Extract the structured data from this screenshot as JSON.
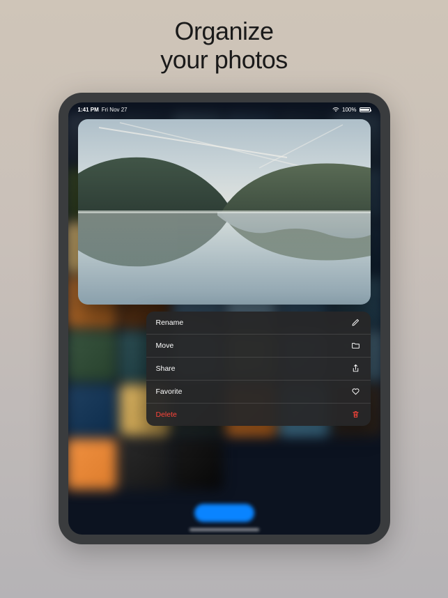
{
  "headline": {
    "line1": "Organize",
    "line2": "your photos"
  },
  "status_bar": {
    "time": "1:41 PM",
    "date": "Fri Nov 27",
    "battery": "100%"
  },
  "context_menu": {
    "items": [
      {
        "label": "Rename",
        "icon": "pencil-icon",
        "destructive": false
      },
      {
        "label": "Move",
        "icon": "folder-icon",
        "destructive": false
      },
      {
        "label": "Share",
        "icon": "share-icon",
        "destructive": false
      },
      {
        "label": "Favorite",
        "icon": "heart-icon",
        "destructive": false
      },
      {
        "label": "Delete",
        "icon": "trash-icon",
        "destructive": true
      }
    ]
  },
  "thumbnails": [
    "#2a3340",
    "#1f2a36",
    "#2c3a47",
    "#233140",
    "#1c2733",
    "#2b3845",
    "#3b4a2a",
    "#4a6b50",
    "#6e8f85",
    "#556b6f",
    "#3e5560",
    "#2e4050",
    "#d0b070",
    "#4a3520",
    "#7a8fa0",
    "#3a5a6a",
    "#2a3548",
    "#203040",
    "#b87030",
    "#6a4020",
    "#50708a",
    "#7899b0",
    "#40607a",
    "#304a5a",
    "#3a5540",
    "#2f5055",
    "#5a8aa0",
    "#9ab088",
    "#6580a0",
    "#4a6575",
    "#204060",
    "#d6b060",
    "#303a3a",
    "#e08030",
    "#5a95b5",
    "#3a3028",
    "#f09040",
    "#2a2a2a",
    "#1a1a1a"
  ],
  "colors": {
    "accent": "#0a84ff",
    "destructive": "#ff453a"
  }
}
